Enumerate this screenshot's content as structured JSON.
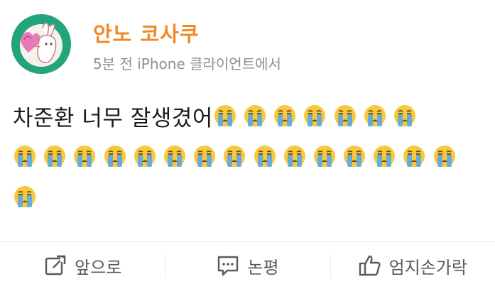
{
  "post": {
    "username": "안노 코사쿠",
    "meta": "5분 전 iPhone 클라이언트에서",
    "text": "차준환 너무 잘생겼어",
    "emoji_icon": "crying-face",
    "emoji_count_line1": 7,
    "emoji_count_line2": 15,
    "emoji_count_line3": 1
  },
  "actions": {
    "share_label": "앞으로",
    "share_icon": "share-icon",
    "comment_label": "논평",
    "comment_icon": "comment-icon",
    "like_label": "엄지손가락",
    "like_icon": "thumbs-up-icon"
  },
  "colors": {
    "username": "#f08a24",
    "meta": "#8f8f8f",
    "avatar_bg": "#24a47c",
    "emoji_face": "#f7c83a",
    "emoji_tears": "#5aa7e8"
  }
}
